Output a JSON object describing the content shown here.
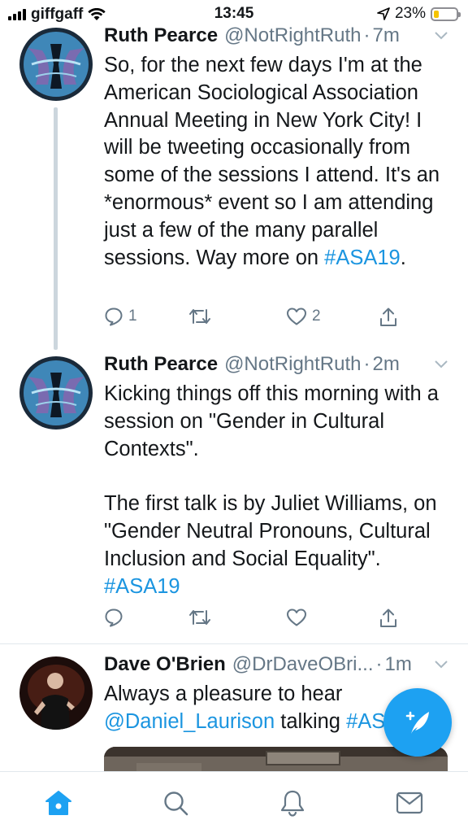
{
  "status_bar": {
    "carrier": "giffgaff",
    "time": "13:45",
    "battery": "23%",
    "battery_level": 0.23
  },
  "tweets": [
    {
      "name": "Ruth Pearce",
      "handle": "@NotRightRuth",
      "dot": "·",
      "time": "7m",
      "text": "So, for the next few days I'm at the American Sociological Association Annual Meeting in New York City! I will be tweeting occasionally from some of the sessions I attend. It's an *enormous* event so I am attending just a few of the many parallel sessions. Way more on ",
      "hashtag": "#ASA19",
      "text_end": ".",
      "reply_count": "1",
      "like_count": "2"
    },
    {
      "name": "Ruth Pearce",
      "handle": "@NotRightRuth",
      "dot": "·",
      "time": "2m",
      "text": "Kicking things off this morning with a session on \"Gender in Cultural Contexts\".\n\nThe first talk is by Juliet Williams, on \"Gender Neutral Pronouns, Cultural Inclusion and Social Equality\". ",
      "hashtag": "#ASA19"
    },
    {
      "name": "Dave O'Brien",
      "handle": "@DrDaveOBri...",
      "dot": "·",
      "time": "1m",
      "text": "Always a pleasure to hear ",
      "mention": "@Daniel_Laurison",
      "text_mid": " talking ",
      "hashtag": "#AS"
    }
  ],
  "icons": {
    "reply": "reply-icon",
    "retweet": "retweet-icon",
    "like": "like-icon",
    "share": "share-icon",
    "compose": "compose-icon",
    "home": "home-icon",
    "search": "search-icon",
    "notifications": "bell-icon",
    "messages": "mail-icon"
  },
  "colors": {
    "accent": "#1da1f2",
    "link": "#1b95e0",
    "muted": "#657786"
  }
}
